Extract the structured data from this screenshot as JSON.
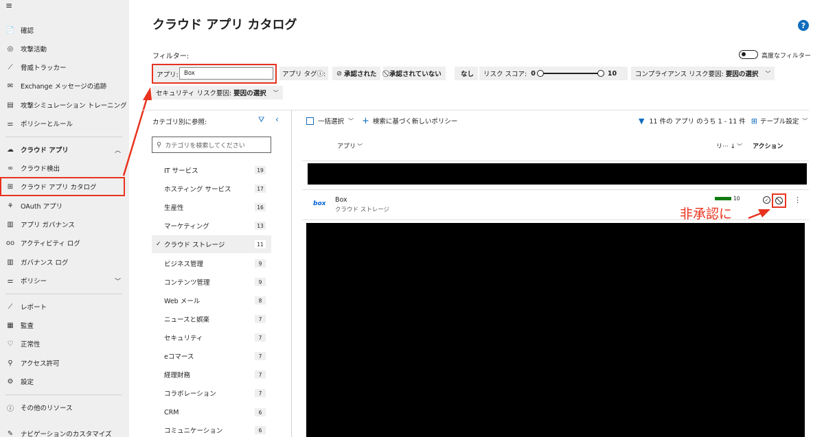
{
  "sidebar": {
    "hamburger": "≡",
    "items": [
      {
        "icon": "📄",
        "label": "確認"
      },
      {
        "icon": "◎",
        "label": "攻撃活動"
      },
      {
        "icon": "⟋",
        "label": "脅威トラッカー"
      },
      {
        "icon": "✉",
        "label": "Exchange メッセージの追跡"
      },
      {
        "icon": "▤",
        "label": "攻撃シミュレーション トレーニング"
      },
      {
        "icon": "⚌",
        "label": "ポリシーとルール"
      },
      {
        "icon": "☁",
        "label": "クラウド アプリ"
      },
      {
        "icon": "∞",
        "label": "クラウド検出"
      },
      {
        "icon": "⊞",
        "label": "クラウド アプリ カタログ"
      },
      {
        "icon": "⚘",
        "label": "OAuth アプリ"
      },
      {
        "icon": "▥",
        "label": "アプリ ガバナンス"
      },
      {
        "icon": "oo",
        "label": "アクティビティ ログ"
      },
      {
        "icon": "▥",
        "label": "ガバナンス ログ"
      },
      {
        "icon": "⚌",
        "label": "ポリシー"
      },
      {
        "icon": "⟋",
        "label": "レポート"
      },
      {
        "icon": "▦",
        "label": "監査"
      },
      {
        "icon": "♡",
        "label": "正常性"
      },
      {
        "icon": "⚲",
        "label": "アクセス許可"
      },
      {
        "icon": "⚙",
        "label": "設定"
      },
      {
        "icon": "ⓘ",
        "label": "その他のリソース"
      },
      {
        "icon": "✎",
        "label": "ナビゲーションのカスタマイズ"
      }
    ]
  },
  "header": {
    "title": "クラウド アプリ カタログ",
    "help": "?"
  },
  "filters": {
    "label": "フィルター:",
    "advanced_label": "高度なフィルター",
    "app_label": "アプリ:",
    "app_value": "Box",
    "app_tag_label": "アプリ タグⓘ:",
    "sanctioned": "承認された",
    "unsanctioned": "承認されていない",
    "none": "なし",
    "risk_label": "リスク スコア:",
    "risk_min": "0",
    "risk_max": "10",
    "compliance_label": "コンプライアンス リスク要因:",
    "compliance_value": "要因の選択",
    "security_label": "セキュリティ リスク要因:",
    "security_value": "要因の選択"
  },
  "categories": {
    "title": "カテゴリ別に参照:",
    "search_placeholder": "カテゴリを検索してください",
    "check": "✓",
    "items": [
      {
        "label": "IT サービス",
        "count": "19"
      },
      {
        "label": "ホスティング サービス",
        "count": "17"
      },
      {
        "label": "生産性",
        "count": "16"
      },
      {
        "label": "マーケティング",
        "count": "13"
      },
      {
        "label": "クラウド ストレージ",
        "count": "11"
      },
      {
        "label": "ビジネス管理",
        "count": "9"
      },
      {
        "label": "コンテンツ管理",
        "count": "9"
      },
      {
        "label": "Web メール",
        "count": "8"
      },
      {
        "label": "ニュースと娯楽",
        "count": "7"
      },
      {
        "label": "セキュリティ",
        "count": "7"
      },
      {
        "label": "eコマース",
        "count": "7"
      },
      {
        "label": "経理財務",
        "count": "7"
      },
      {
        "label": "コラボレーション",
        "count": "7"
      },
      {
        "label": "CRM",
        "count": "6"
      },
      {
        "label": "コミュニケーション",
        "count": "6"
      }
    ]
  },
  "table": {
    "bulk_select": "一括選択",
    "new_policy": "検索に基づく新しいポリシー",
    "count_text": "11 件の アプリ のうち 1 - 11 件",
    "table_settings": "テーブル設定",
    "col_app": "アプリ",
    "col_risk": "リ··· ↓",
    "col_action": "アクション",
    "row": {
      "logo": "box",
      "name": "Box",
      "category": "クラウド ストレージ",
      "risk": "10"
    }
  },
  "annotation": "非承認に"
}
